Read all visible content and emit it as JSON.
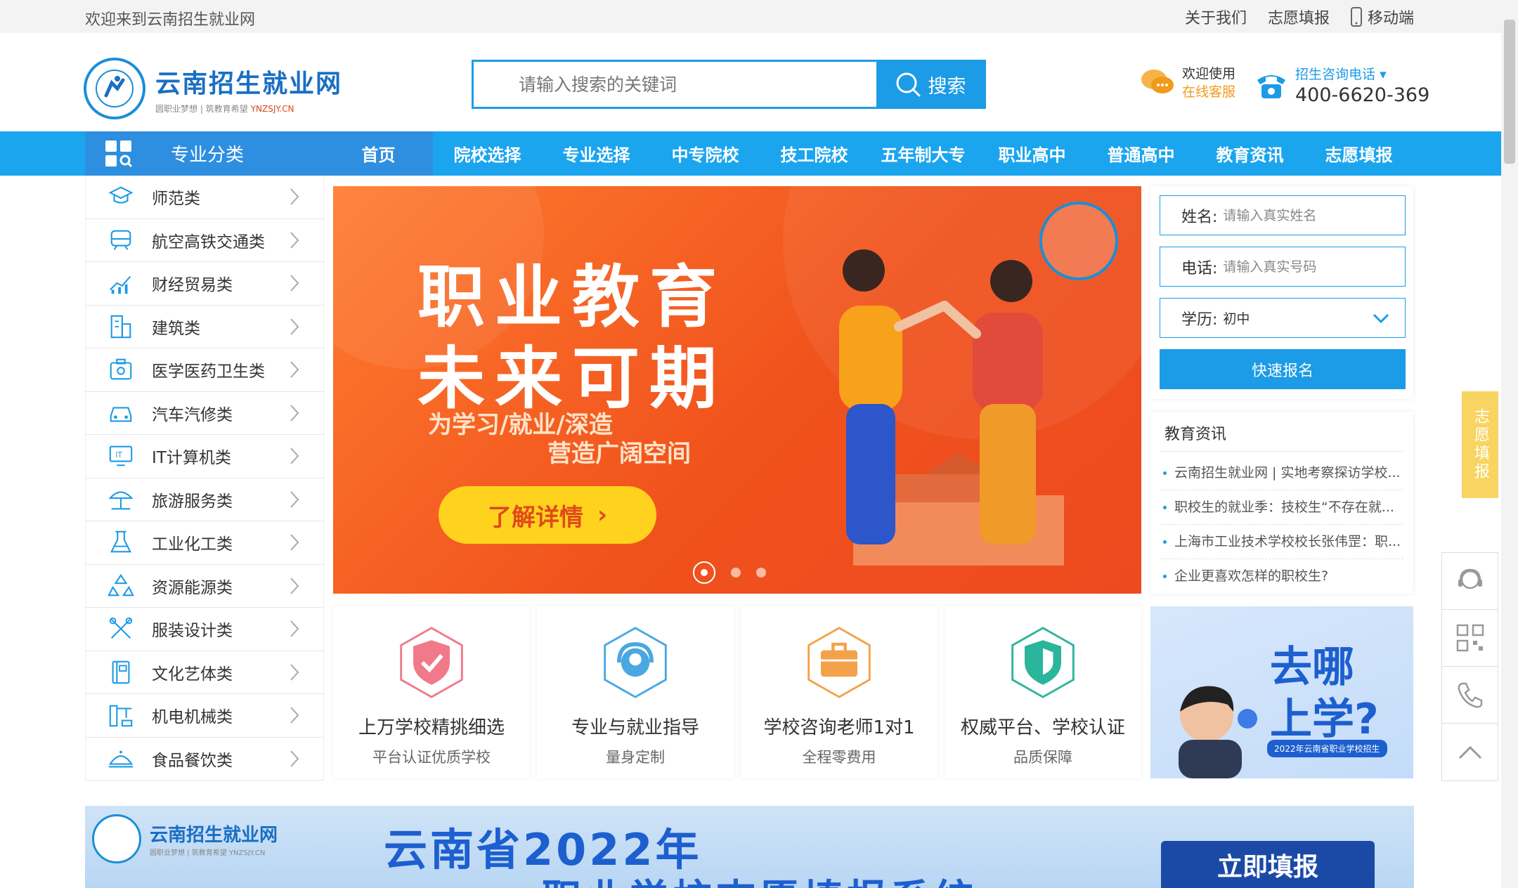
{
  "topbar": {
    "welcome": "欢迎来到云南招生就业网",
    "links": [
      "关于我们",
      "志愿填报",
      "移动端"
    ]
  },
  "logo": {
    "name": "云南招生就业网",
    "slogan": "圆职业梦想 | 筑教育希望",
    "domain": "YNZSJY.CN"
  },
  "search": {
    "placeholder": "请输入搜索的关键词",
    "button_label": "搜索"
  },
  "service": {
    "line1": "欢迎使用",
    "line2": "在线客服"
  },
  "hotline": {
    "label": "招生咨询电话",
    "number": "400-6620-369"
  },
  "nav": {
    "category_label": "专业分类",
    "items": [
      "首页",
      "院校选择",
      "专业选择",
      "中专院校",
      "技工院校",
      "五年制大专",
      "职业高中",
      "普通高中",
      "教育资讯",
      "志愿填报"
    ]
  },
  "categories": [
    {
      "label": "师范类",
      "icon": "graduation-cap-icon"
    },
    {
      "label": "航空高铁交通类",
      "icon": "train-icon"
    },
    {
      "label": "财经贸易类",
      "icon": "chart-icon"
    },
    {
      "label": "建筑类",
      "icon": "building-icon"
    },
    {
      "label": "医学医药卫生类",
      "icon": "medical-kit-icon"
    },
    {
      "label": "汽车汽修类",
      "icon": "car-icon"
    },
    {
      "label": "IT计算机类",
      "icon": "computer-icon"
    },
    {
      "label": "旅游服务类",
      "icon": "umbrella-icon"
    },
    {
      "label": "工业化工类",
      "icon": "flask-icon"
    },
    {
      "label": "资源能源类",
      "icon": "recycle-icon"
    },
    {
      "label": "服装设计类",
      "icon": "scissors-icon"
    },
    {
      "label": "文化艺体类",
      "icon": "book-icon"
    },
    {
      "label": "机电机械类",
      "icon": "machine-icon"
    },
    {
      "label": "食品餐饮类",
      "icon": "food-icon"
    }
  ],
  "banner": {
    "title1": "职业教育",
    "title2": "未来可期",
    "sub1": "为学习/就业/深造",
    "sub2": "营造广阔空间",
    "button": "了解详情",
    "dots": 3,
    "active_dot": 1
  },
  "form": {
    "name_label": "姓名:",
    "name_placeholder": "请输入真实姓名",
    "phone_label": "电话:",
    "phone_placeholder": "请输入真实号码",
    "edu_label": "学历:",
    "edu_value": "初中",
    "submit": "快速报名"
  },
  "news": {
    "title": "教育资讯",
    "items": [
      "云南招生就业网 | 实地考察探访学校...",
      "职校生的就业季：技校生“不存在就...",
      "上海市工业技术学校校长张伟罡：职...",
      "企业更喜欢怎样的职校生?"
    ]
  },
  "features": [
    {
      "title": "上万学校精挑细选",
      "sub": "平台认证优质学校",
      "color": "#f07a8a",
      "icon": "shield-check-icon"
    },
    {
      "title": "专业与就业指导",
      "sub": "量身定制",
      "color": "#4aa8e0",
      "icon": "headset-icon"
    },
    {
      "title": "学校咨询老师1对1",
      "sub": "全程零费用",
      "color": "#f3a24a",
      "icon": "briefcase-icon"
    },
    {
      "title": "权威平台、学校认证",
      "sub": "品质保障",
      "color": "#2bb59a",
      "icon": "shield-icon"
    }
  ],
  "promo": {
    "line1": "去哪",
    "line2": "上学?",
    "tag": "2022年云南省职业学校招生"
  },
  "bottom_banner": {
    "logo_name": "云南招生就业网",
    "logo_slogan": "圆职业梦想 | 筑教育希望  YNZSJY.CN",
    "headline": "云南省2022年",
    "headline2": "职业学校志愿填报系统",
    "button": "立即填报"
  },
  "float": {
    "tab_label": "志愿填报"
  },
  "colors": {
    "primary": "#1ba5ef",
    "nav_dark": "#2e8fe0",
    "accent_orange": "#f0521c",
    "yellow": "#ffd21e"
  }
}
